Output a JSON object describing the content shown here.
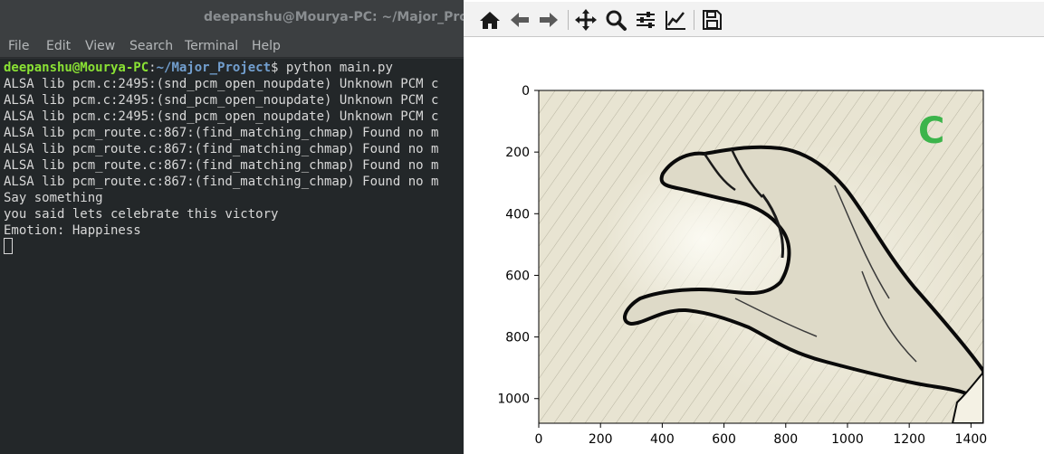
{
  "terminal": {
    "title": "deepanshu@Mourya-PC: ~/Major_Project",
    "menu": [
      "File",
      "Edit",
      "View",
      "Search",
      "Terminal",
      "Help"
    ],
    "prompt_user": "deepanshu@Mourya-PC",
    "prompt_sep": ":",
    "prompt_path": "~/Major_Project",
    "prompt_dollar": "$",
    "command": " python main.py",
    "lines": [
      "ALSA lib pcm.c:2495:(snd_pcm_open_noupdate) Unknown PCM c",
      "ALSA lib pcm.c:2495:(snd_pcm_open_noupdate) Unknown PCM c",
      "ALSA lib pcm.c:2495:(snd_pcm_open_noupdate) Unknown PCM c",
      "ALSA lib pcm_route.c:867:(find_matching_chmap) Found no m",
      "ALSA lib pcm_route.c:867:(find_matching_chmap) Found no m",
      "ALSA lib pcm_route.c:867:(find_matching_chmap) Found no m",
      "ALSA lib pcm_route.c:867:(find_matching_chmap) Found no m",
      "Say something",
      "you said lets celebrate this victory",
      "Emotion: Happiness"
    ]
  },
  "figure": {
    "toolbar": [
      "home-icon",
      "back-icon",
      "forward-icon",
      "pan-icon",
      "zoom-icon",
      "configure-subplots-icon",
      "edit-axes-icon",
      "save-icon"
    ],
    "image_label": "C",
    "image_label_color": "#3cb44b",
    "colors": {
      "image_bg": "#e8e4d2",
      "hand": "#dedac8",
      "outline": "#0a0a0a"
    }
  },
  "chart_data": {
    "type": "image",
    "x_ticks": [
      0,
      200,
      400,
      600,
      800,
      1000,
      1200,
      1400
    ],
    "y_ticks": [
      0,
      200,
      400,
      600,
      800,
      1000
    ],
    "xlim": [
      0,
      1440
    ],
    "ylim": [
      1080,
      0
    ],
    "grid": false
  }
}
